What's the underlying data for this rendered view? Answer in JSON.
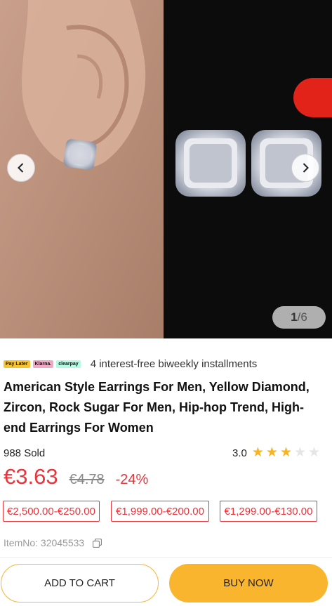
{
  "gallery": {
    "current_index": "1",
    "total_separator": "/6",
    "prev_icon": "chevron-left-icon",
    "next_icon": "chevron-right-icon"
  },
  "payment": {
    "logos": [
      "Pay Later",
      "Klarna.",
      "clearpay"
    ],
    "text": "4 interest-free biweekly installments"
  },
  "product": {
    "title": "American Style Earrings For Men, Yellow Diamond, Zircon, Rock Sugar For Men, Hip-hop Trend, High-end Earrings For Women",
    "sold": "988 Sold",
    "rating": "3.0",
    "rating_value": 3,
    "rating_max": 5,
    "price": "€3.63",
    "old_price": "€4.78",
    "discount": "-24%",
    "item_no": "ItemNo: 32045533"
  },
  "coupons": [
    "€2,500.00-€250.00",
    "€1,999.00-€200.00",
    "€1,299.00-€130.00"
  ],
  "actions": {
    "add_to_cart": "ADD TO CART",
    "buy_now": "BUY NOW"
  },
  "colors": {
    "price_red": "#e8343b",
    "accent_yellow": "#fab52e",
    "star_gold": "#f5b325",
    "star_empty": "#e5e5e5"
  }
}
